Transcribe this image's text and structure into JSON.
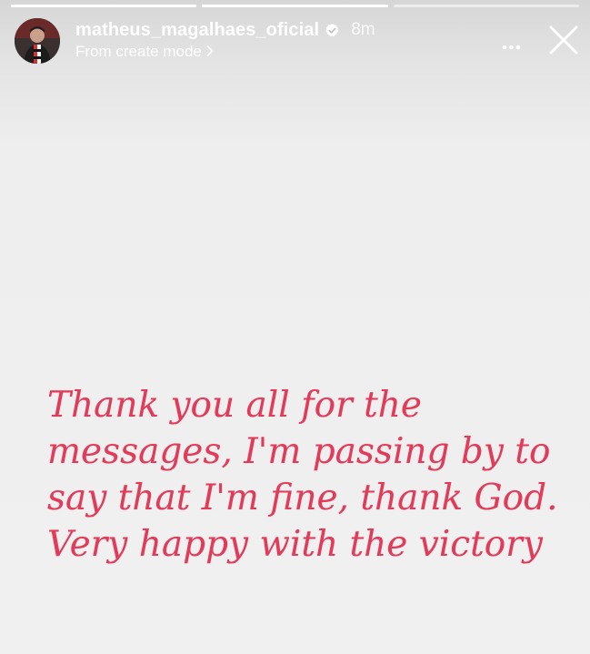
{
  "story": {
    "progress": [
      1.0,
      1.0,
      0.0
    ],
    "username": "matheus_magalhaes_oficial",
    "verified": true,
    "time": "8m",
    "subtitle": "From create mode",
    "message_lines": [
      "Thank you all for the",
      "messages, I'm passing by to",
      "say that I'm fine, thank God.",
      "Very happy with the victory"
    ],
    "text_color": "#e23b5a",
    "background_color": "#f0f0f0",
    "icons": {
      "verified": "verified-badge-icon",
      "subtitle_arrow": "chevron-right-icon",
      "more": "more-options-icon",
      "close": "close-icon"
    }
  }
}
